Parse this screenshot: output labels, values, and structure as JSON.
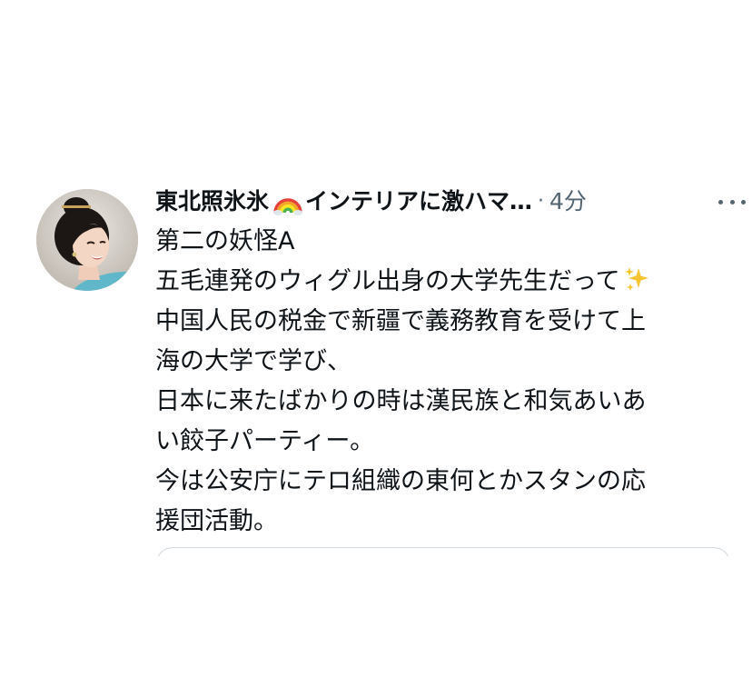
{
  "post": {
    "author": {
      "name": "東北照氷氷",
      "name_suffix": "インテリアに激ハマ…",
      "emoji": "rainbow-emoji"
    },
    "separator": "·",
    "time": "4分",
    "more_icon": "more-horizontal-icon",
    "text_lines": [
      "第二の妖怪A",
      "五毛連発のウィグル出身の大学先生だって",
      "中国人民の税金で新疆で義務教育を受けて上",
      "海の大学で学び、",
      "日本に来たばかりの時は漢民族と和気あいあ",
      "い餃子パーティー。",
      "今は公安庁にテロ組織の東何とかスタンの応",
      "援団活動。"
    ],
    "sparkle_icon": "sparkles-emoji"
  },
  "colors": {
    "text": "#0f1419",
    "secondary": "#536471",
    "border": "#cfd9de",
    "background": "#ffffff"
  }
}
